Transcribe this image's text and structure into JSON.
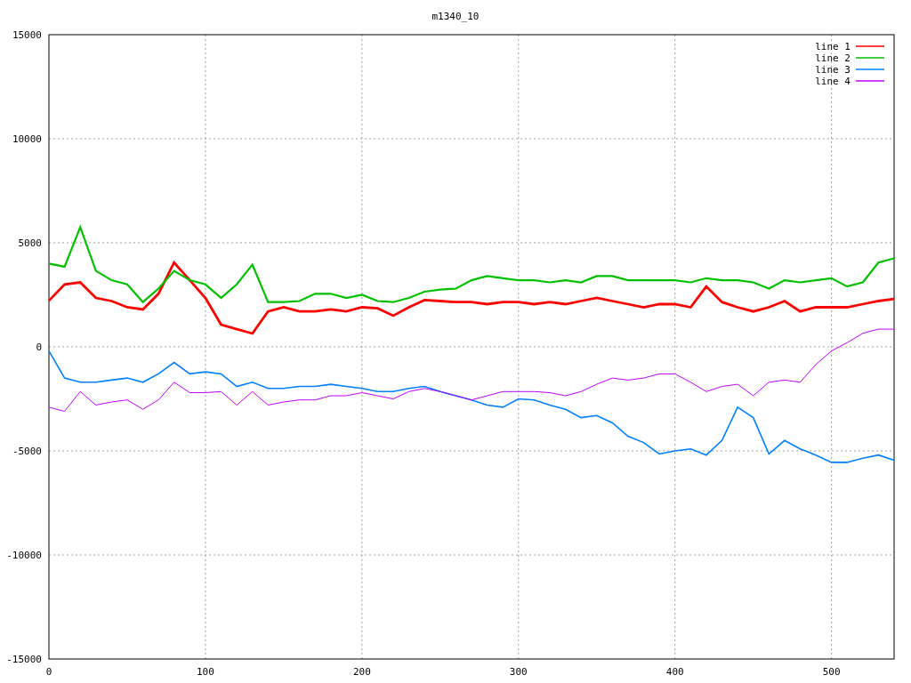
{
  "chart_data": {
    "type": "line",
    "title": "m1340_10",
    "grid": true,
    "legend": true,
    "xlim": [
      0,
      540
    ],
    "ylim": [
      -15000,
      15000
    ],
    "xticks": [
      0,
      100,
      200,
      300,
      400,
      500
    ],
    "yticks": [
      -15000,
      -10000,
      -5000,
      0,
      5000,
      10000,
      15000
    ],
    "x": [
      0,
      10,
      20,
      30,
      40,
      50,
      60,
      70,
      80,
      90,
      100,
      110,
      120,
      130,
      140,
      150,
      160,
      170,
      180,
      190,
      200,
      210,
      220,
      230,
      240,
      250,
      260,
      270,
      280,
      290,
      300,
      310,
      320,
      330,
      340,
      350,
      360,
      370,
      380,
      390,
      400,
      410,
      420,
      430,
      440,
      450,
      460,
      470,
      480,
      490,
      500,
      510,
      520,
      530,
      540
    ],
    "series": [
      {
        "name": "line 1",
        "color": "#ff0000",
        "values": [
          2220,
          3000,
          3100,
          2350,
          2200,
          1900,
          1800,
          2550,
          4050,
          3200,
          2350,
          1070,
          850,
          640,
          1700,
          1900,
          1700,
          1700,
          1800,
          1700,
          1900,
          1850,
          1500,
          1900,
          2250,
          2200,
          2150,
          2150,
          2050,
          2150,
          2150,
          2050,
          2150,
          2050,
          2200,
          2350,
          2200,
          2050,
          1900,
          2050,
          2050,
          1900,
          2900,
          2150,
          1900,
          1700,
          1900,
          2200,
          1700,
          1900,
          1900,
          1900,
          2050,
          2200,
          2300
        ]
      },
      {
        "name": "line 2",
        "color": "#00c000",
        "values": [
          4000,
          3850,
          5750,
          3650,
          3200,
          3000,
          2150,
          2800,
          3650,
          3200,
          3000,
          2350,
          3000,
          3950,
          2150,
          2150,
          2200,
          2550,
          2550,
          2350,
          2500,
          2200,
          2150,
          2350,
          2650,
          2750,
          2800,
          3200,
          3400,
          3300,
          3200,
          3200,
          3100,
          3200,
          3100,
          3400,
          3400,
          3200,
          3200,
          3200,
          3200,
          3100,
          3300,
          3200,
          3200,
          3100,
          2800,
          3200,
          3100,
          3200,
          3300,
          2900,
          3100,
          4050,
          4250
        ]
      },
      {
        "name": "line 3",
        "color": "#0080ff",
        "values": [
          -200,
          -1500,
          -1700,
          -1700,
          -1600,
          -1500,
          -1700,
          -1300,
          -750,
          -1300,
          -1200,
          -1300,
          -1900,
          -1700,
          -2000,
          -2000,
          -1900,
          -1900,
          -1800,
          -1900,
          -2000,
          -2150,
          -2150,
          -2000,
          -1900,
          -2150,
          -2350,
          -2550,
          -2800,
          -2900,
          -2500,
          -2550,
          -2800,
          -3000,
          -3400,
          -3300,
          -3650,
          -4300,
          -4600,
          -5150,
          -5000,
          -4900,
          -5200,
          -4500,
          -2900,
          -3400,
          -5150,
          -4500,
          -4900,
          -5200,
          -5550,
          -5550,
          -5350,
          -5200,
          -5450
        ]
      },
      {
        "name": "line 4",
        "color": "#c000ff",
        "values": [
          -2900,
          -3100,
          -2150,
          -2800,
          -2650,
          -2550,
          -3000,
          -2550,
          -1700,
          -2200,
          -2200,
          -2150,
          -2800,
          -2150,
          -2800,
          -2650,
          -2550,
          -2550,
          -2350,
          -2350,
          -2200,
          -2350,
          -2500,
          -2150,
          -2000,
          -2150,
          -2350,
          -2550,
          -2350,
          -2150,
          -2150,
          -2150,
          -2200,
          -2350,
          -2150,
          -1800,
          -1500,
          -1600,
          -1500,
          -1300,
          -1300,
          -1700,
          -2150,
          -1900,
          -1800,
          -2350,
          -1700,
          -1600,
          -1700,
          -850,
          -200,
          200,
          650,
          850,
          850
        ]
      }
    ]
  }
}
